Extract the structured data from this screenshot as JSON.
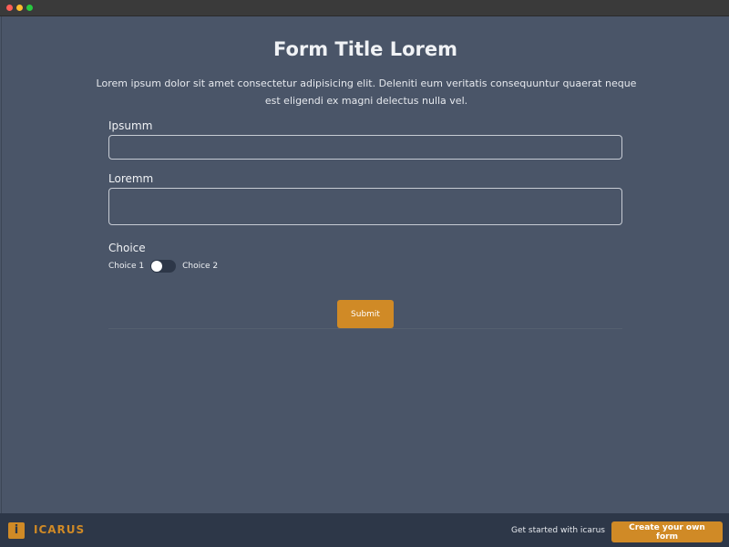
{
  "window": {
    "controls": [
      "close",
      "minimize",
      "zoom"
    ]
  },
  "form": {
    "title": "Form Title Lorem",
    "description": "Lorem ipsum dolor sit amet consectetur adipisicing elit. Deleniti eum veritatis consequuntur quaerat neque est eligendi ex magni delectus nulla vel.",
    "fields": {
      "ipsum": {
        "label": "Ipsumm",
        "value": "",
        "placeholder": ""
      },
      "lorem": {
        "label": "Loremm",
        "value": "",
        "placeholder": ""
      },
      "choice": {
        "label": "Choice",
        "option_left": "Choice 1",
        "option_right": "Choice 2",
        "selected": "Choice 1"
      }
    },
    "submit_label": "Submit"
  },
  "footer": {
    "logo_letter": "i",
    "brand": "ICARUS",
    "tagline": "Get started with icarus",
    "cta_label": "Create your own form"
  },
  "colors": {
    "background": "#4a5568",
    "footer": "#2d3748",
    "accent": "#d08a26"
  }
}
